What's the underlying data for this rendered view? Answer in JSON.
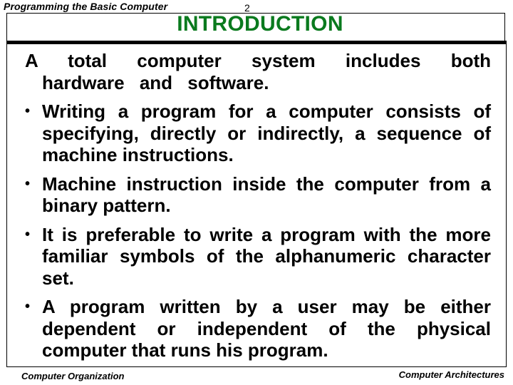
{
  "header": {
    "running_title": "Programming the Basic Computer",
    "page_number": "2"
  },
  "slide": {
    "title": "INTRODUCTION",
    "title_color": "#0a7a1e",
    "intro": "A total computer system includes both hardware and software.",
    "bullets": [
      "Writing a program for a computer consists of specifying, directly or indirectly, a sequence of machine instructions.",
      "Machine instruction inside the computer from a binary pattern.",
      "It is preferable to write a program with the more familiar symbols of the alphanumeric character set.",
      "A program written by a user may be either dependent or independent of the physical computer that runs his program."
    ],
    "bullet_glyph": "•"
  },
  "footer": {
    "left": "Computer Organization",
    "right": "Computer Architectures"
  }
}
